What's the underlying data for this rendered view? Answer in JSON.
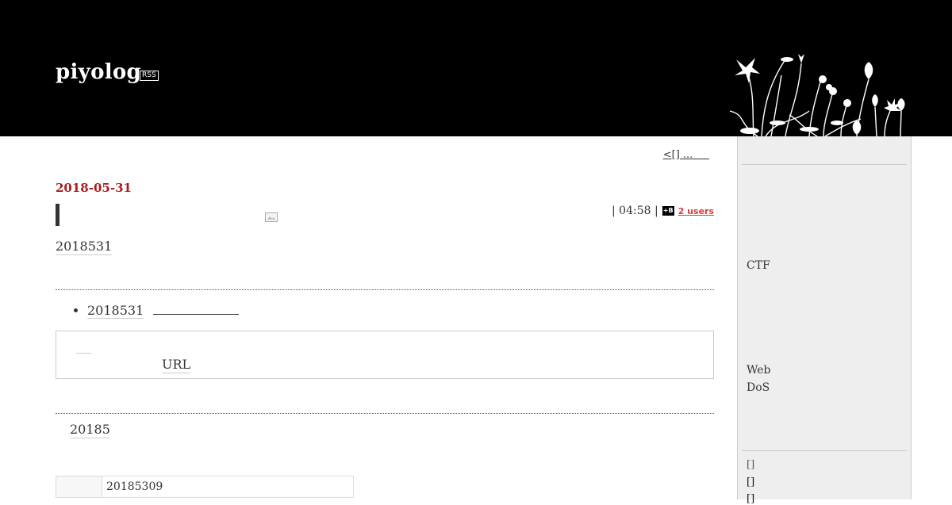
{
  "header": {
    "blog_title": "piyolog",
    "rss_label": "RSS"
  },
  "main": {
    "pager_label": "<[] ...",
    "date": "2018-05-31",
    "meta_time": "| 04:58 |",
    "hatena_icon": "+B",
    "hatena_users": "2 users",
    "intro_text": "2018531",
    "bullet_items": [
      "2018531"
    ],
    "embed_url_label": "URL",
    "year_month": "20185",
    "table_rows": [
      [
        "",
        "20185309"
      ]
    ]
  },
  "sidebar": {
    "ctf_label": "CTF",
    "web_label": "Web",
    "dos_label": "DoS",
    "archive_links": [
      "[]",
      "[]",
      "[]"
    ]
  }
}
